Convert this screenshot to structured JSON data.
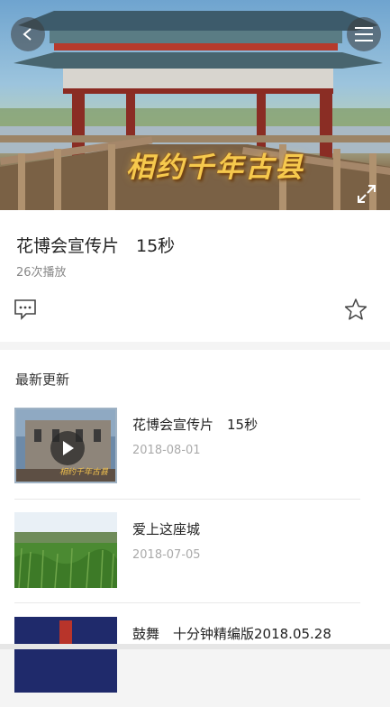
{
  "player": {
    "caption": "相约千年古县"
  },
  "video": {
    "title": "花博会宣传片　15秒",
    "play_count": "26次播放"
  },
  "icons": {
    "back": "chevron-left-icon",
    "menu": "hamburger-menu-icon",
    "fullscreen": "expand-icon",
    "comment": "comment-bubble-icon",
    "favorite": "star-outline-icon",
    "play": "play-icon"
  },
  "latest": {
    "heading": "最新更新",
    "items": [
      {
        "title": "花博会宣传片　15秒",
        "date": "2018-08-01"
      },
      {
        "title": "爱上这座城",
        "date": "2018-07-05"
      },
      {
        "title": "鼓舞　十分钟精编版2018.05.28",
        "date": ""
      }
    ]
  },
  "colors": {
    "caption_gold": "#f6c94d",
    "divider": "#e8e8e8",
    "date_gray": "#aaaaaa"
  }
}
